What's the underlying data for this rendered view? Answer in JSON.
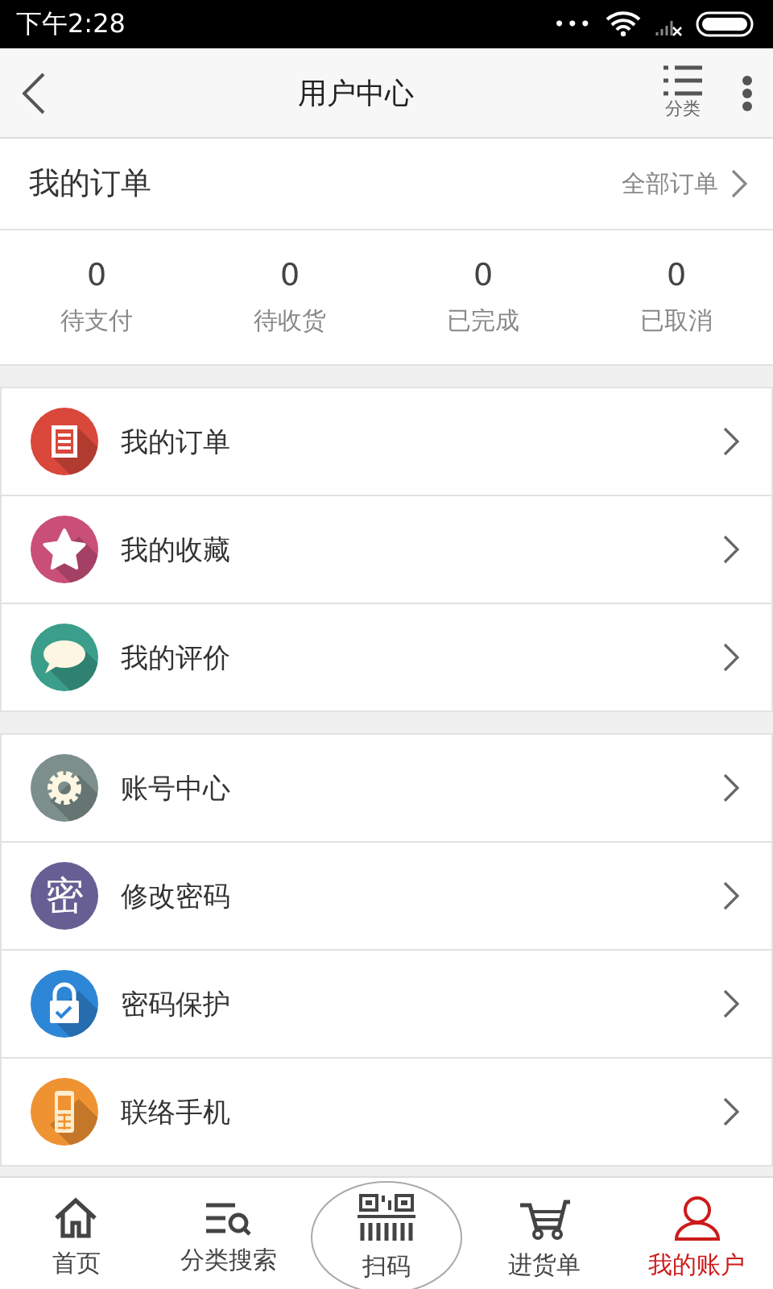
{
  "status_bar": {
    "time": "下午2:28",
    "dots": "•••"
  },
  "header": {
    "title": "用户中心",
    "category_label": "分类"
  },
  "orders": {
    "title": "我的订单",
    "all_link": "全部订单",
    "counts": [
      {
        "value": "0",
        "label": "待支付"
      },
      {
        "value": "0",
        "label": "待收货"
      },
      {
        "value": "0",
        "label": "已完成"
      },
      {
        "value": "0",
        "label": "已取消"
      }
    ]
  },
  "menu_groups": [
    [
      {
        "label": "我的订单",
        "kind": "document",
        "color": "#d9483b"
      },
      {
        "label": "我的收藏",
        "kind": "star",
        "color": "#c94f79"
      },
      {
        "label": "我的评价",
        "kind": "chat",
        "color": "#3a9e8a"
      }
    ],
    [
      {
        "label": "账号中心",
        "kind": "gear",
        "color": "#7d8f8c"
      },
      {
        "label": "修改密码",
        "kind": "character",
        "icon_text": "密",
        "color": "#675e93"
      },
      {
        "label": "密码保护",
        "kind": "lock",
        "color": "#2e86d6"
      },
      {
        "label": "联络手机",
        "kind": "phone",
        "color": "#ef9231"
      }
    ]
  ],
  "tab_bar": [
    {
      "label": "首页",
      "kind": "home",
      "selected": false
    },
    {
      "label": "分类搜索",
      "kind": "search",
      "selected": false
    },
    {
      "label": "扫码",
      "kind": "scan",
      "selected": false
    },
    {
      "label": "进货单",
      "kind": "cart",
      "selected": false
    },
    {
      "label": "我的账户",
      "kind": "user",
      "selected": true
    }
  ]
}
